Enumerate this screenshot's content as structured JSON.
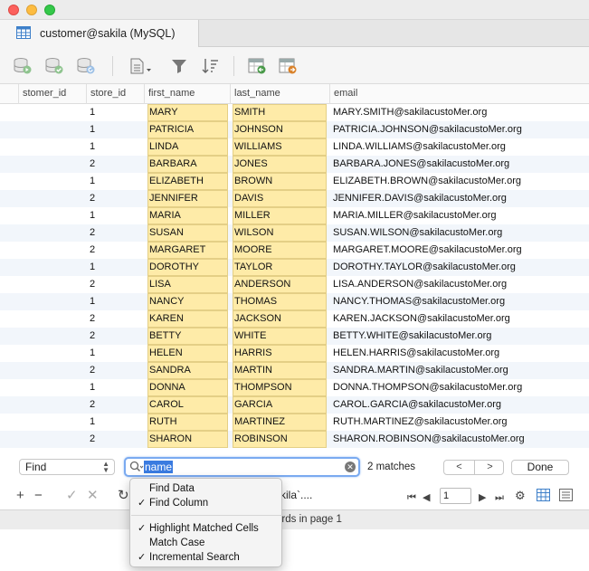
{
  "window": {
    "tab_title": "customer@sakila (MySQL)"
  },
  "icons": {
    "tab": "table-icon",
    "toolbar": [
      "run-query-icon",
      "commit-icon",
      "rollback-icon",
      "document-menu-icon",
      "filter-icon",
      "sort-icon",
      "import-icon",
      "export-icon"
    ]
  },
  "grid": {
    "columns": [
      "stomer_id",
      "store_id",
      "first_name",
      "last_name",
      "email"
    ],
    "rows": [
      {
        "store_id": "1",
        "first_name": "MARY",
        "last_name": "SMITH",
        "email": "MARY.SMITH@sakilacustoMer.org"
      },
      {
        "store_id": "1",
        "first_name": "PATRICIA",
        "last_name": "JOHNSON",
        "email": "PATRICIA.JOHNSON@sakilacustoMer.org"
      },
      {
        "store_id": "1",
        "first_name": "LINDA",
        "last_name": "WILLIAMS",
        "email": "LINDA.WILLIAMS@sakilacustoMer.org"
      },
      {
        "store_id": "2",
        "first_name": "BARBARA",
        "last_name": "JONES",
        "email": "BARBARA.JONES@sakilacustoMer.org"
      },
      {
        "store_id": "1",
        "first_name": "ELIZABETH",
        "last_name": "BROWN",
        "email": "ELIZABETH.BROWN@sakilacustoMer.org"
      },
      {
        "store_id": "2",
        "first_name": "JENNIFER",
        "last_name": "DAVIS",
        "email": "JENNIFER.DAVIS@sakilacustoMer.org"
      },
      {
        "store_id": "1",
        "first_name": "MARIA",
        "last_name": "MILLER",
        "email": "MARIA.MILLER@sakilacustoMer.org"
      },
      {
        "store_id": "2",
        "first_name": "SUSAN",
        "last_name": "WILSON",
        "email": "SUSAN.WILSON@sakilacustoMer.org"
      },
      {
        "store_id": "2",
        "first_name": "MARGARET",
        "last_name": "MOORE",
        "email": "MARGARET.MOORE@sakilacustoMer.org"
      },
      {
        "store_id": "1",
        "first_name": "DOROTHY",
        "last_name": "TAYLOR",
        "email": "DOROTHY.TAYLOR@sakilacustoMer.org"
      },
      {
        "store_id": "2",
        "first_name": "LISA",
        "last_name": "ANDERSON",
        "email": "LISA.ANDERSON@sakilacustoMer.org"
      },
      {
        "store_id": "1",
        "first_name": "NANCY",
        "last_name": "THOMAS",
        "email": "NANCY.THOMAS@sakilacustoMer.org"
      },
      {
        "store_id": "2",
        "first_name": "KAREN",
        "last_name": "JACKSON",
        "email": "KAREN.JACKSON@sakilacustoMer.org"
      },
      {
        "store_id": "2",
        "first_name": "BETTY",
        "last_name": "WHITE",
        "email": "BETTY.WHITE@sakilacustoMer.org"
      },
      {
        "store_id": "1",
        "first_name": "HELEN",
        "last_name": "HARRIS",
        "email": "HELEN.HARRIS@sakilacustoMer.org"
      },
      {
        "store_id": "2",
        "first_name": "SANDRA",
        "last_name": "MARTIN",
        "email": "SANDRA.MARTIN@sakilacustoMer.org"
      },
      {
        "store_id": "1",
        "first_name": "DONNA",
        "last_name": "THOMPSON",
        "email": "DONNA.THOMPSON@sakilacustoMer.org"
      },
      {
        "store_id": "2",
        "first_name": "CAROL",
        "last_name": "GARCIA",
        "email": "CAROL.GARCIA@sakilacustoMer.org"
      },
      {
        "store_id": "1",
        "first_name": "RUTH",
        "last_name": "MARTINEZ",
        "email": "RUTH.MARTINEZ@sakilacustoMer.org"
      },
      {
        "store_id": "2",
        "first_name": "SHARON",
        "last_name": "ROBINSON",
        "email": "SHARON.ROBINSON@sakilacustoMer.org"
      }
    ]
  },
  "find": {
    "scope_value": "Find",
    "search_value": "name",
    "matches_label": "2 matches",
    "prev_glyph": "<",
    "next_glyph": ">",
    "done_label": "Done"
  },
  "find_menu": {
    "items": [
      {
        "label": "Find Data",
        "checked": false
      },
      {
        "label": "Find Column",
        "checked": true
      },
      {
        "label": "Highlight Matched Cells",
        "checked": true
      },
      {
        "label": "Match Case",
        "checked": false
      },
      {
        "label": "Incremental Search",
        "checked": true
      }
    ]
  },
  "bottom": {
    "partial_sql": "kila`....",
    "page_number": "1",
    "status_text": "ords in page 1"
  },
  "colors": {
    "highlight": "#feeba8",
    "focus_ring": "#7aaaf0",
    "alt_row": "#f2f6fb"
  }
}
